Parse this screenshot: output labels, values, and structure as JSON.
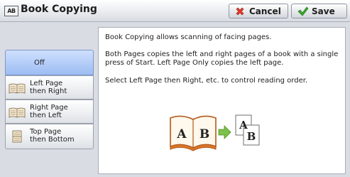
{
  "window": {
    "title": "Book Copying",
    "title_icon": "AB"
  },
  "toolbar": {
    "cancel_label": "Cancel",
    "save_label": "Save"
  },
  "options": [
    {
      "label_line1": "Off",
      "label_line2": "",
      "selected": true
    },
    {
      "label_line1": "Left Page",
      "label_line2": "then Right",
      "selected": false
    },
    {
      "label_line1": "Right Page",
      "label_line2": "then Left",
      "selected": false
    },
    {
      "label_line1": "Top Page",
      "label_line2": "then Bottom",
      "selected": false
    }
  ],
  "description": {
    "p1": "Book Copying allows scanning of facing pages.",
    "p2": "Both Pages copies the left and right pages of a book with a single press of Start.  Left Page Only copies the left page.",
    "p3": "Select Left Page then Right, etc. to control reading order."
  },
  "illustration": {
    "book_left": "A",
    "book_right": "B",
    "page_a": "A",
    "page_b": "B"
  },
  "colors": {
    "selected_bg": "#9cbcf2",
    "cancel_x": "#e03c2a",
    "save_check": "#3aa82c",
    "arrow": "#7cc24a",
    "book": "#d9762a"
  }
}
